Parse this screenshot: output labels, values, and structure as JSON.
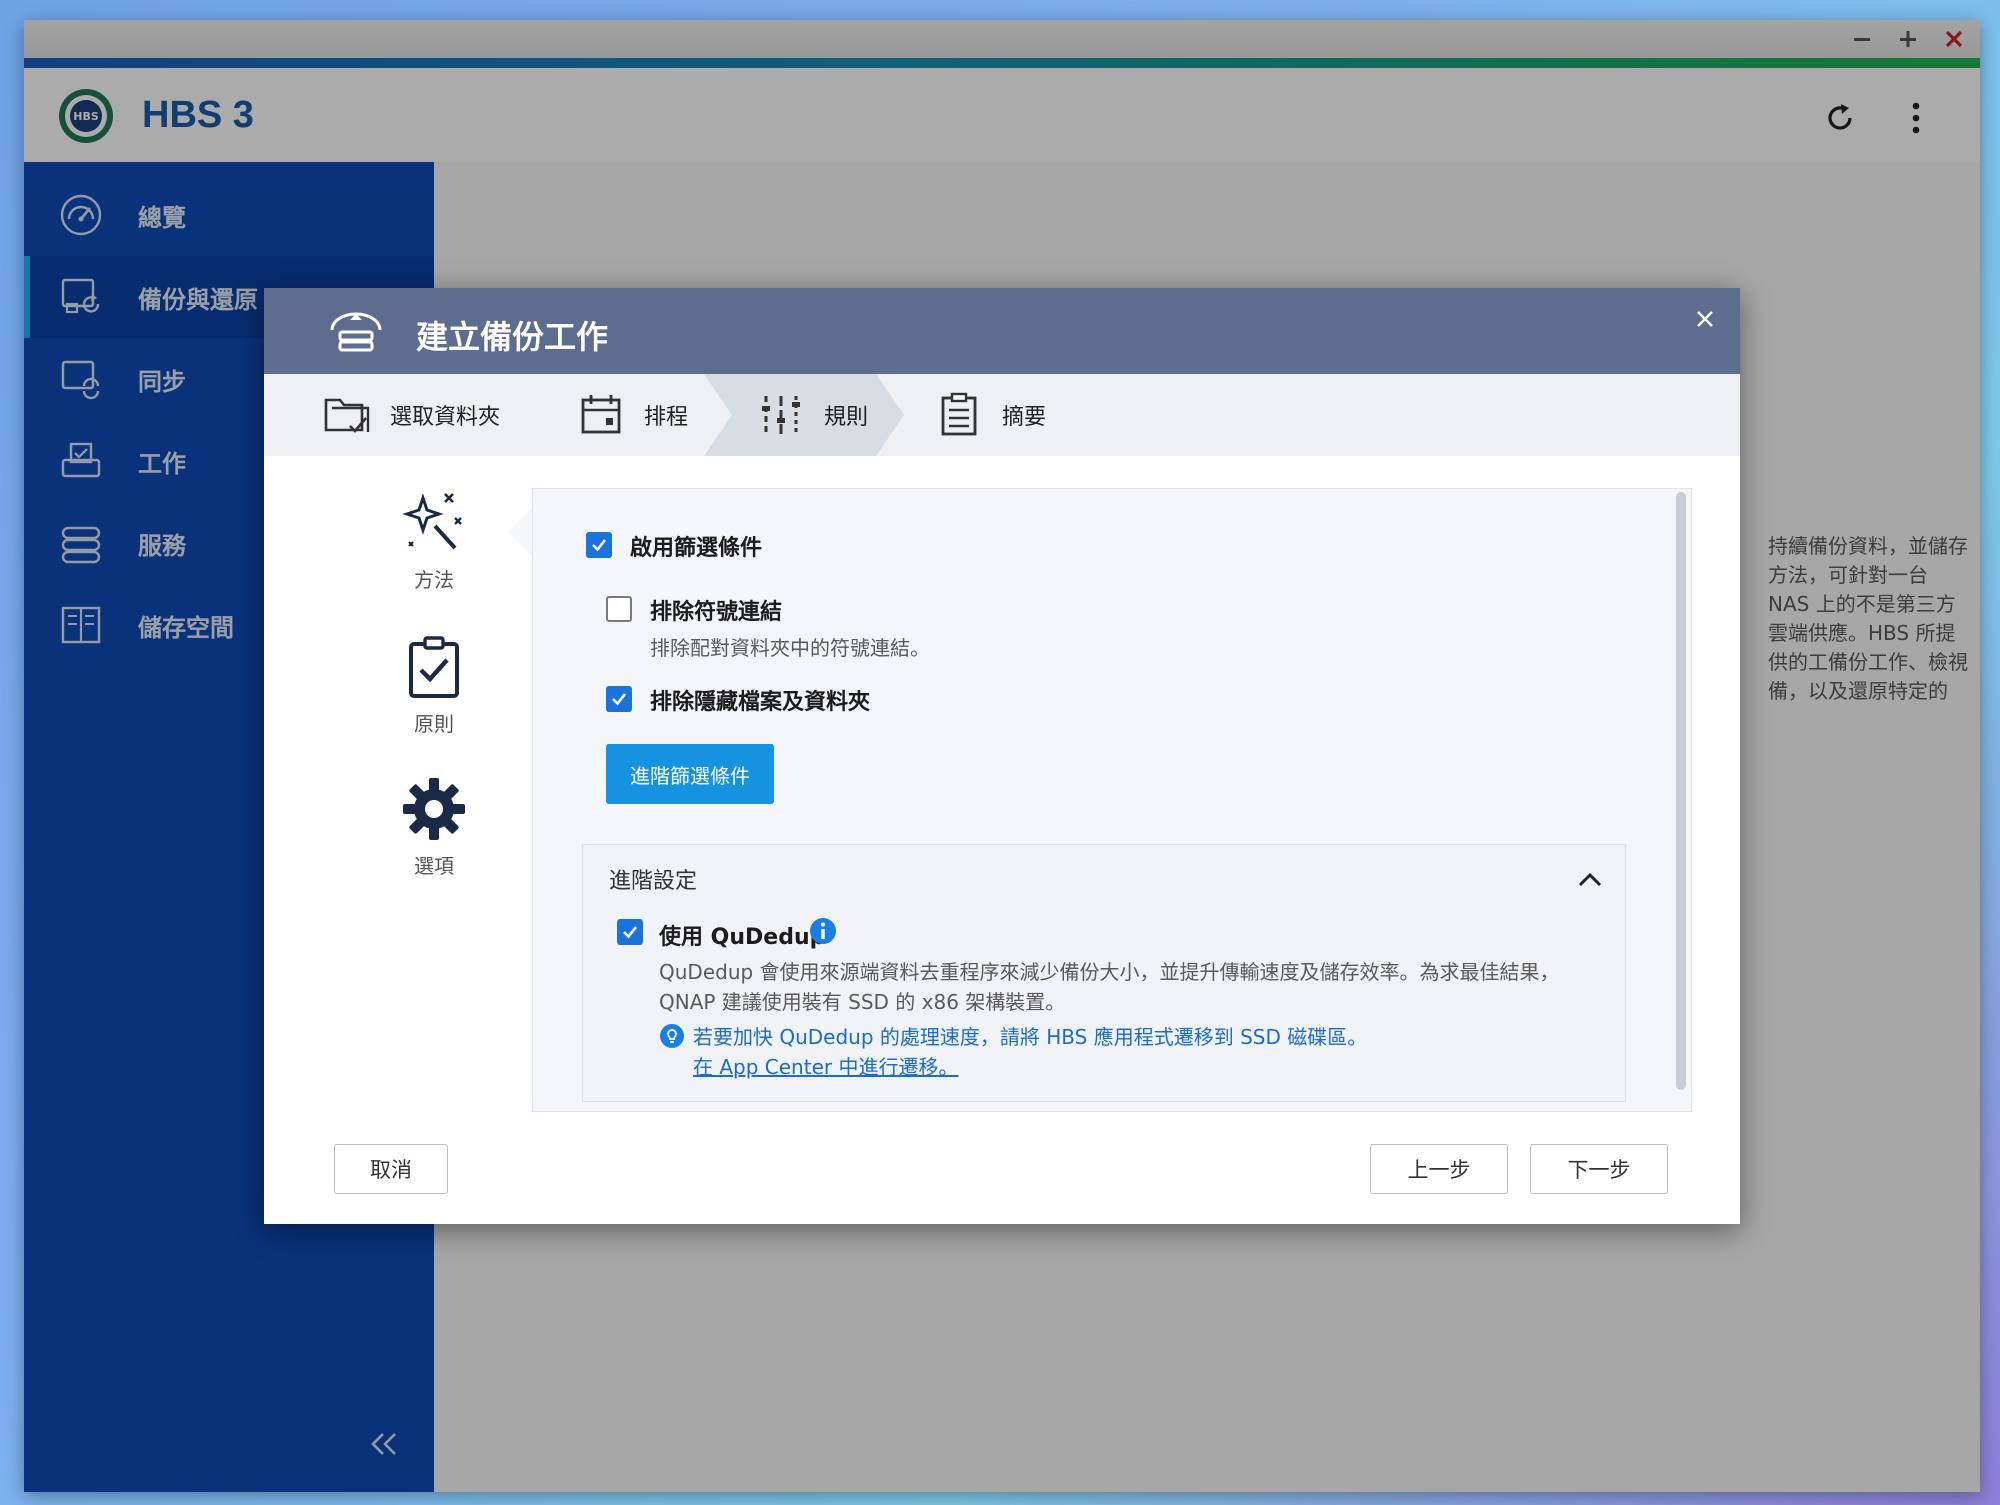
{
  "app": {
    "title": "HBS 3",
    "logo_text": "HBS"
  },
  "window_controls": [
    "minimize-icon",
    "maximize-icon",
    "close-icon"
  ],
  "sidebar": {
    "items": [
      {
        "label": "總覽",
        "icon": "gauge-icon"
      },
      {
        "label": "備份與還原",
        "icon": "backup-restore-icon"
      },
      {
        "label": "同步",
        "icon": "sync-icon"
      },
      {
        "label": "工作",
        "icon": "job-icon"
      },
      {
        "label": "服務",
        "icon": "services-icon"
      },
      {
        "label": "儲存空間",
        "icon": "storage-icon"
      }
    ],
    "active_index": 1
  },
  "background_text": "持續備份資料，並儲存方法，可針對一台 NAS 上的不是第三方雲端供應。HBS 所提供的工備份工作、檢視備，以及還原特定的",
  "modal": {
    "title": "建立備份工作",
    "steps": [
      {
        "label": "選取資料夾"
      },
      {
        "label": "排程"
      },
      {
        "label": "規則"
      },
      {
        "label": "摘要"
      }
    ],
    "active_step": 2,
    "left_nav": [
      {
        "label": "方法"
      },
      {
        "label": "原則"
      },
      {
        "label": "選項"
      }
    ],
    "filter": {
      "enable_label": "啟用篩選條件",
      "enable_checked": true,
      "exclude_symlinks_label": "排除符號連結",
      "exclude_symlinks_checked": false,
      "exclude_symlinks_desc": "排除配對資料夾中的符號連結。",
      "exclude_hidden_label": "排除隱藏檔案及資料夾",
      "exclude_hidden_checked": true,
      "advanced_filter_button": "進階篩選條件"
    },
    "advanced": {
      "title": "進階設定",
      "qudedup_label": "使用 QuDedup",
      "qudedup_checked": true,
      "qudedup_desc": "QuDedup 會使用來源端資料去重程序來減少備份大小，並提升傳輸速度及儲存效率。為求最佳結果，QNAP 建議使用裝有 SSD 的 x86 架構裝置。",
      "tip_text": "若要加快 QuDedup 的處理速度，請將 HBS 應用程式遷移到 SSD 磁碟區。",
      "tip_link": "在 App Center 中進行遷移。"
    },
    "buttons": {
      "cancel": "取消",
      "back": "上一步",
      "next": "下一步"
    }
  },
  "colors": {
    "sidebar": "#0e4bb8",
    "modal_header": "#5e6c8e",
    "primary_button": "#1593e0",
    "checkbox": "#1a73d9",
    "link": "#1a6ccc"
  }
}
